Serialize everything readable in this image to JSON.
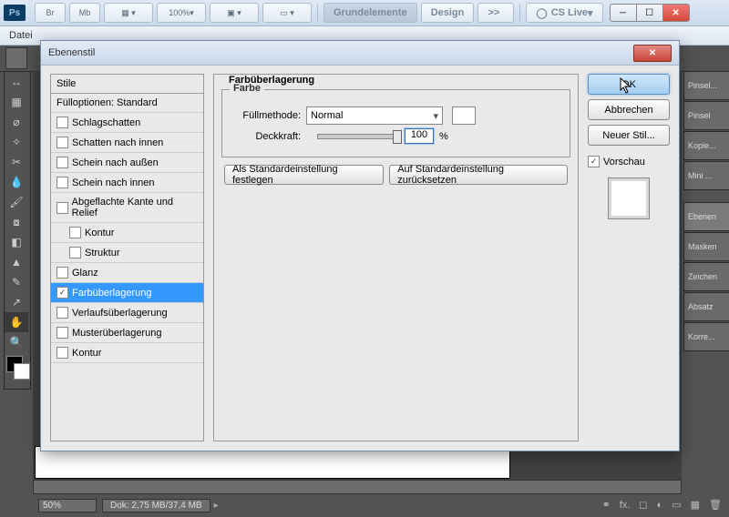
{
  "app": {
    "logo": "Ps",
    "zoom": "100%"
  },
  "titlebar": {
    "btn_br": "Br",
    "btn_mb": "Mb",
    "grundelemente": "Grundelemente",
    "design": "Design",
    "more": ">>",
    "cslive": "CS Live"
  },
  "menubar": {
    "file": "Datei"
  },
  "panels": {
    "pinsel": "Pinsel...",
    "pinsel2": "Pinsel",
    "kopie": "Kopie...",
    "mini": "Mini ...",
    "ebenen": "Ebenen",
    "masken": "Masken",
    "zeichen": "Zeichen",
    "absatz": "Absatz",
    "korre": "Korre..."
  },
  "status": {
    "zoom": "50%",
    "dok": "Dok: 2,75 MB/37,4 MB"
  },
  "dialog": {
    "title": "Ebenenstil",
    "section": "Farbüberlagerung",
    "farbe_legend": "Farbe",
    "fuellmethode_lbl": "Füllmethode:",
    "fuellmethode_val": "Normal",
    "deckkraft_lbl": "Deckkraft:",
    "deckkraft_val": "100",
    "pct": "%",
    "btn_default": "Als Standardeinstellung festlegen",
    "btn_reset": "Auf Standardeinstellung zurücksetzen",
    "ok": "OK",
    "cancel": "Abbrechen",
    "neu": "Neuer Stil...",
    "vorschau": "Vorschau",
    "styles_head": "Stile",
    "styles": [
      {
        "label": "Fülloptionen: Standard",
        "check": false,
        "indent": false
      },
      {
        "label": "Schlagschatten",
        "check": true,
        "indent": false
      },
      {
        "label": "Schatten nach innen",
        "check": true,
        "indent": false
      },
      {
        "label": "Schein nach außen",
        "check": true,
        "indent": false
      },
      {
        "label": "Schein nach innen",
        "check": true,
        "indent": false
      },
      {
        "label": "Abgeflachte Kante und Relief",
        "check": true,
        "indent": false
      },
      {
        "label": "Kontur",
        "check": true,
        "indent": true
      },
      {
        "label": "Struktur",
        "check": true,
        "indent": true
      },
      {
        "label": "Glanz",
        "check": true,
        "indent": false
      },
      {
        "label": "Farbüberlagerung",
        "check": true,
        "indent": false,
        "selected": true,
        "checked": true
      },
      {
        "label": "Verlaufsüberlagerung",
        "check": true,
        "indent": false
      },
      {
        "label": "Musterüberlagerung",
        "check": true,
        "indent": false
      },
      {
        "label": "Kontur",
        "check": true,
        "indent": false
      }
    ]
  }
}
